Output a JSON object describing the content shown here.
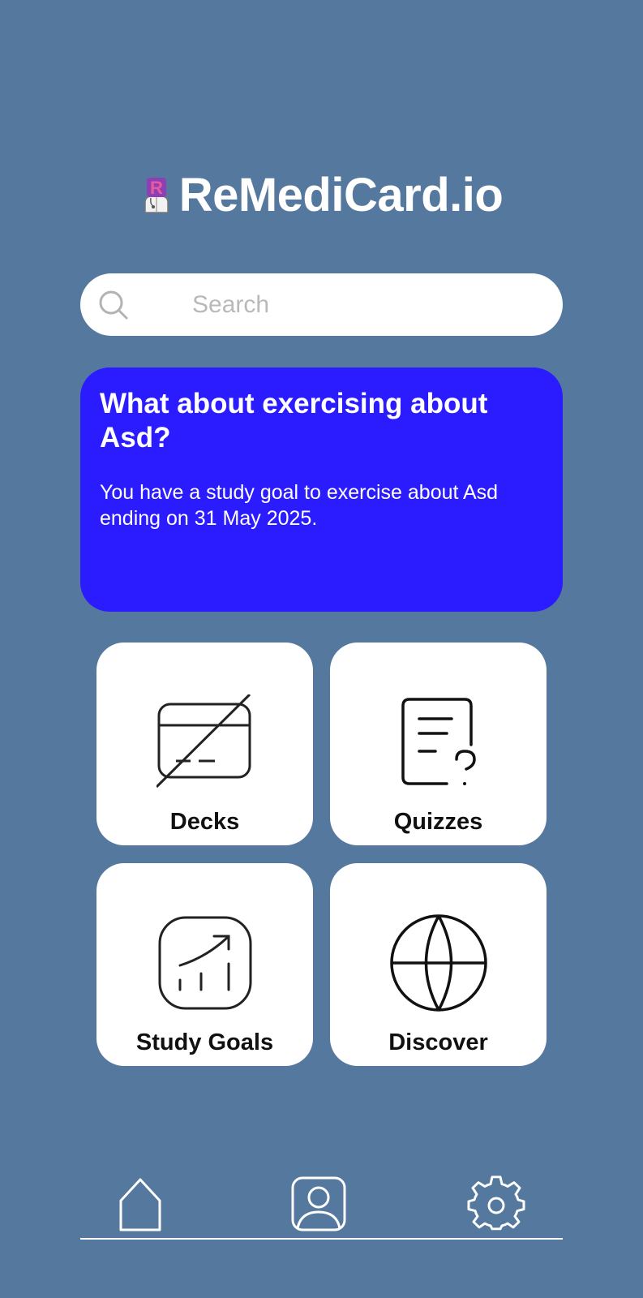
{
  "app": {
    "title": "ReMediCard.io"
  },
  "search": {
    "placeholder": "Search",
    "value": ""
  },
  "banner": {
    "title": "What about exercising about Asd?",
    "text": "You have a study goal to exercise about Asd ending on 31 May 2025.",
    "color": "#2a1cff"
  },
  "tiles": [
    {
      "label": "Decks",
      "icon": "card-slash-icon"
    },
    {
      "label": "Quizzes",
      "icon": "quiz-document-icon"
    },
    {
      "label": "Study Goals",
      "icon": "chart-trend-icon"
    },
    {
      "label": "Discover",
      "icon": "globe-icon"
    }
  ],
  "nav": {
    "items": [
      {
        "icon": "home-icon"
      },
      {
        "icon": "profile-icon"
      },
      {
        "icon": "gear-icon"
      }
    ]
  },
  "colors": {
    "background": "#55799e",
    "surface": "#ffffff",
    "accent": "#2a1cff"
  }
}
